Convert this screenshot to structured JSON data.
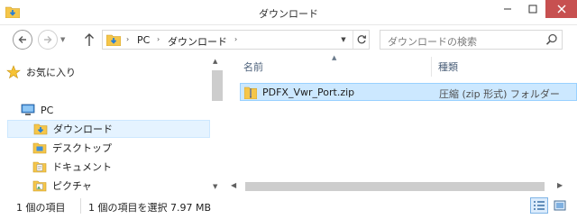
{
  "window": {
    "title": "ダウンロード",
    "minimize_glyph": "—",
    "maximize_glyph": "☐",
    "close_glyph": "✕"
  },
  "nav": {
    "back_icon": "arrow-left-icon",
    "forward_icon": "arrow-right-icon",
    "up_icon": "arrow-up-icon"
  },
  "address": {
    "segments": [
      "PC",
      "ダウンロード"
    ],
    "separator": "›"
  },
  "search": {
    "placeholder": "ダウンロードの検索"
  },
  "sidebar": {
    "items": [
      {
        "label": "お気に入り",
        "icon": "star-icon"
      },
      {
        "label": "PC",
        "icon": "computer-icon"
      },
      {
        "label": "ダウンロード",
        "icon": "download-folder-icon",
        "selected": true
      },
      {
        "label": "デスクトップ",
        "icon": "desktop-folder-icon"
      },
      {
        "label": "ドキュメント",
        "icon": "documents-folder-icon"
      },
      {
        "label": "ピクチャ",
        "icon": "pictures-folder-icon"
      }
    ]
  },
  "filelist": {
    "columns": {
      "name": "名前",
      "type": "種類"
    },
    "files": [
      {
        "name": "PDFX_Vwr_Port.zip",
        "type": "圧縮 (zip 形式) フォルダー",
        "selected": true
      }
    ]
  },
  "status": {
    "item_count": "1 個の項目",
    "selection": "1 個の項目を選択  7.97 MB"
  },
  "colors": {
    "selection_bg": "#cce8ff",
    "selection_border": "#99d1ff",
    "close_button": "#c75050",
    "folder_yellow": "#f5c64a",
    "download_arrow": "#2a7fd4"
  }
}
